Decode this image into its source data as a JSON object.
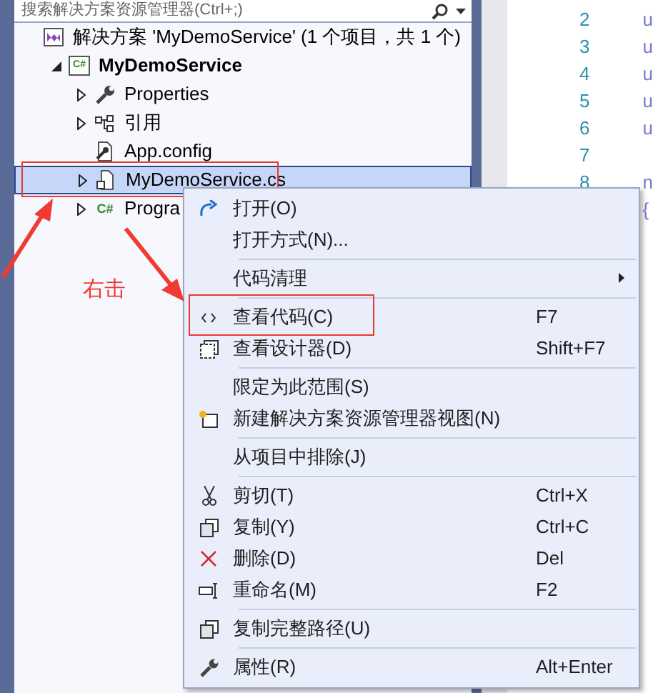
{
  "search": {
    "placeholder": "搜索解决方案资源管理器(Ctrl+;)"
  },
  "tree": [
    {
      "kind": "solution",
      "label": "解决方案 'MyDemoService' (1 个项目，共 1 个)",
      "selected": false,
      "children": [
        {
          "kind": "project",
          "icon_text": "C#",
          "label": "MyDemoService",
          "expanded": true,
          "selected": false,
          "children": [
            {
              "kind": "properties",
              "label": "Properties",
              "expanded": false,
              "selected": false
            },
            {
              "kind": "references",
              "label": "引用",
              "expanded": false,
              "selected": false
            },
            {
              "kind": "config",
              "label": "App.config",
              "selected": false
            },
            {
              "kind": "file",
              "label": "MyDemoService.cs",
              "expanded": false,
              "selected": true,
              "annotated": true
            },
            {
              "kind": "class",
              "icon_text": "C#",
              "label": "Progra",
              "expanded": false,
              "selected": false
            }
          ]
        }
      ]
    }
  ],
  "editor": {
    "lines": [
      {
        "number": "2",
        "code": "u"
      },
      {
        "number": "3",
        "code": "u"
      },
      {
        "number": "4",
        "code": "u"
      },
      {
        "number": "5",
        "code": "u"
      },
      {
        "number": "6",
        "code": "u"
      },
      {
        "number": "7"
      },
      {
        "number": "8",
        "code": "n"
      },
      {
        "code": "{"
      }
    ]
  },
  "context_menu": [
    {
      "kind": "item",
      "label": "打开(O)"
    },
    {
      "kind": "item",
      "label": "打开方式(N)..."
    },
    {
      "kind": "separator"
    },
    {
      "kind": "item",
      "label": "代码清理",
      "submenu": true
    },
    {
      "kind": "separator"
    },
    {
      "kind": "item",
      "label": "查看代码(C)",
      "shortcut": "F7",
      "annotated": true
    },
    {
      "kind": "item",
      "label": "查看设计器(D)",
      "shortcut": "Shift+F7"
    },
    {
      "kind": "separator"
    },
    {
      "kind": "item",
      "label": "限定为此范围(S)"
    },
    {
      "kind": "item",
      "label": "新建解决方案资源管理器视图(N)"
    },
    {
      "kind": "separator"
    },
    {
      "kind": "item",
      "label": "从项目中排除(J)"
    },
    {
      "kind": "separator"
    },
    {
      "kind": "item",
      "label": "剪切(T)",
      "shortcut": "Ctrl+X"
    },
    {
      "kind": "item",
      "label": "复制(Y)",
      "shortcut": "Ctrl+C"
    },
    {
      "kind": "item",
      "label": "删除(D)",
      "shortcut": "Del"
    },
    {
      "kind": "item",
      "label": "重命名(M)",
      "shortcut": "F2"
    },
    {
      "kind": "separator"
    },
    {
      "kind": "item",
      "label": "复制完整路径(U)"
    },
    {
      "kind": "separator"
    },
    {
      "kind": "item",
      "label": "属性(R)",
      "shortcut": "Alt+Enter"
    }
  ],
  "annotation": {
    "label": "右击"
  }
}
